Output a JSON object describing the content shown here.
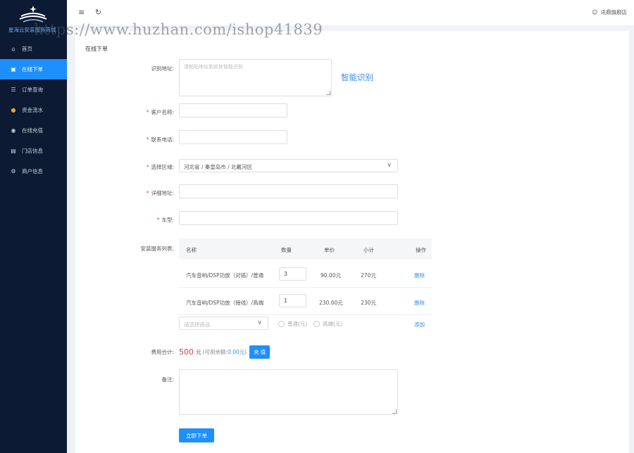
{
  "app": {
    "name": "星海云安装服务商城"
  },
  "sidebar": {
    "items": [
      {
        "label": "首页",
        "icon": "home-icon",
        "active": false
      },
      {
        "label": "在线下单",
        "icon": "order-icon",
        "active": true
      },
      {
        "label": "订单查询",
        "icon": "list-icon",
        "active": false
      },
      {
        "label": "资金流水",
        "icon": "money-bag-icon",
        "active": false
      },
      {
        "label": "在线充值",
        "icon": "recharge-icon",
        "active": false
      },
      {
        "label": "门店信息",
        "icon": "store-icon",
        "active": false
      },
      {
        "label": "商户信息",
        "icon": "gear-icon",
        "active": false
      }
    ]
  },
  "header": {
    "user_name": "讯鼎旗舰店"
  },
  "watermark": "https://www.huzhan.com/ishop41839",
  "page": {
    "title": "在线下单"
  },
  "form": {
    "recognize": {
      "label": "识别地址:",
      "placeholder": "请粘贴地址到此处智能识别",
      "button": "智能识别"
    },
    "customer_name": {
      "label": "客户名称:",
      "value": ""
    },
    "phone": {
      "label": "联系电话:",
      "value": ""
    },
    "region": {
      "label": "选择区域:",
      "value": "河北省 / 秦皇岛市 / 北戴河区"
    },
    "address": {
      "label": "详细地址:",
      "value": ""
    },
    "car_model": {
      "label": "车型:",
      "value": ""
    },
    "services": {
      "label": "安装服务列表:",
      "columns": [
        "名称",
        "数量",
        "单价",
        "小计",
        "操作"
      ],
      "rows": [
        {
          "name": "汽车音响/DSP功放（对插）/普通",
          "qty": "3",
          "price": "90.00元",
          "subtotal": "270元",
          "action": "删除"
        },
        {
          "name": "汽车音响/DSP功放（接线）/高端",
          "qty": "1",
          "price": "230.00元",
          "subtotal": "230元",
          "action": "删除"
        }
      ],
      "product_select_placeholder": "请选择商品",
      "radio_normal": "普通(元)",
      "radio_high": "高端(元)",
      "add_label": "添加"
    },
    "total": {
      "label": "费用合计:",
      "amount": "500",
      "currency": "元",
      "balance_label": "(可用余额:",
      "balance_value": "0.00元",
      "balance_close": ")",
      "recharge_label": "充 值"
    },
    "remark": {
      "label": "备注:",
      "value": ""
    },
    "submit_label": "立即下单"
  },
  "colors": {
    "sidebar_bg": "#0c1a33",
    "accent": "#1e8fff",
    "required": "#e74c3c",
    "amount": "#e23b3b",
    "link": "#3a8ee6"
  }
}
